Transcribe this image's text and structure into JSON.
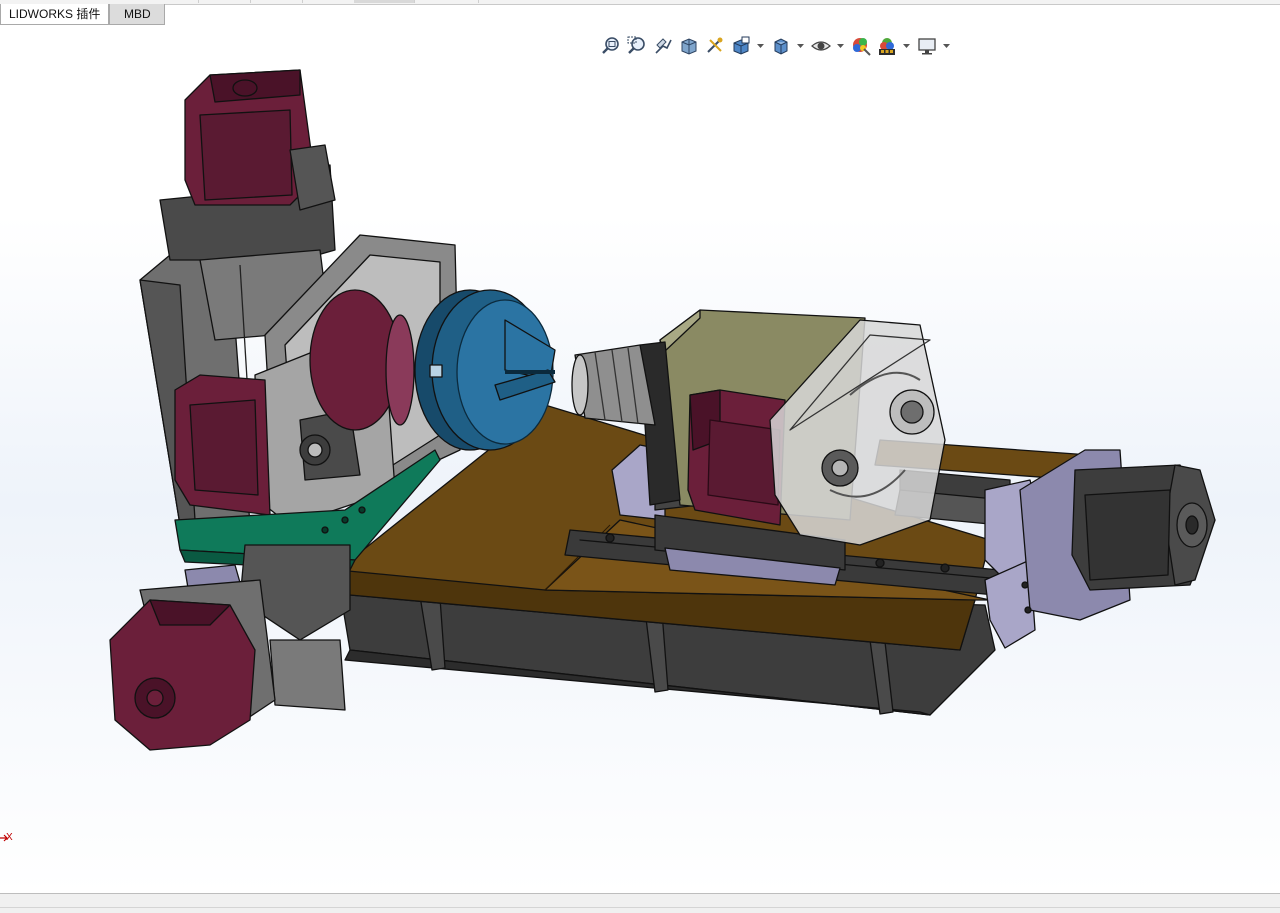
{
  "tabs": [
    {
      "label": "LIDWORKS 插件",
      "active": false
    },
    {
      "label": "MBD",
      "active": true
    }
  ],
  "hud_icons": [
    "zoom-to-fit-icon",
    "zoom-to-area-icon",
    "previous-view-icon",
    "section-view-icon",
    "dynamic-annotation-icon",
    "view-orientation-icon",
    "display-style-icon",
    "hide-show-items-icon",
    "edit-appearance-icon",
    "apply-scene-icon",
    "view-settings-icon"
  ],
  "triad": {
    "axis_label": "X"
  },
  "colors": {
    "motor": "#6b1f3a",
    "motor_dark": "#4a1228",
    "steel": "#6f6f6f",
    "steel_dark": "#3d3d3d",
    "wood": "#6b4a14",
    "wood_light": "#8a6420",
    "green_plate": "#0f7a5a",
    "chuck_blue": "#1f5f86",
    "spindle_khaki": "#8a8a63",
    "lavender": "#a9a6c8",
    "glass": "#d7d7d7"
  }
}
